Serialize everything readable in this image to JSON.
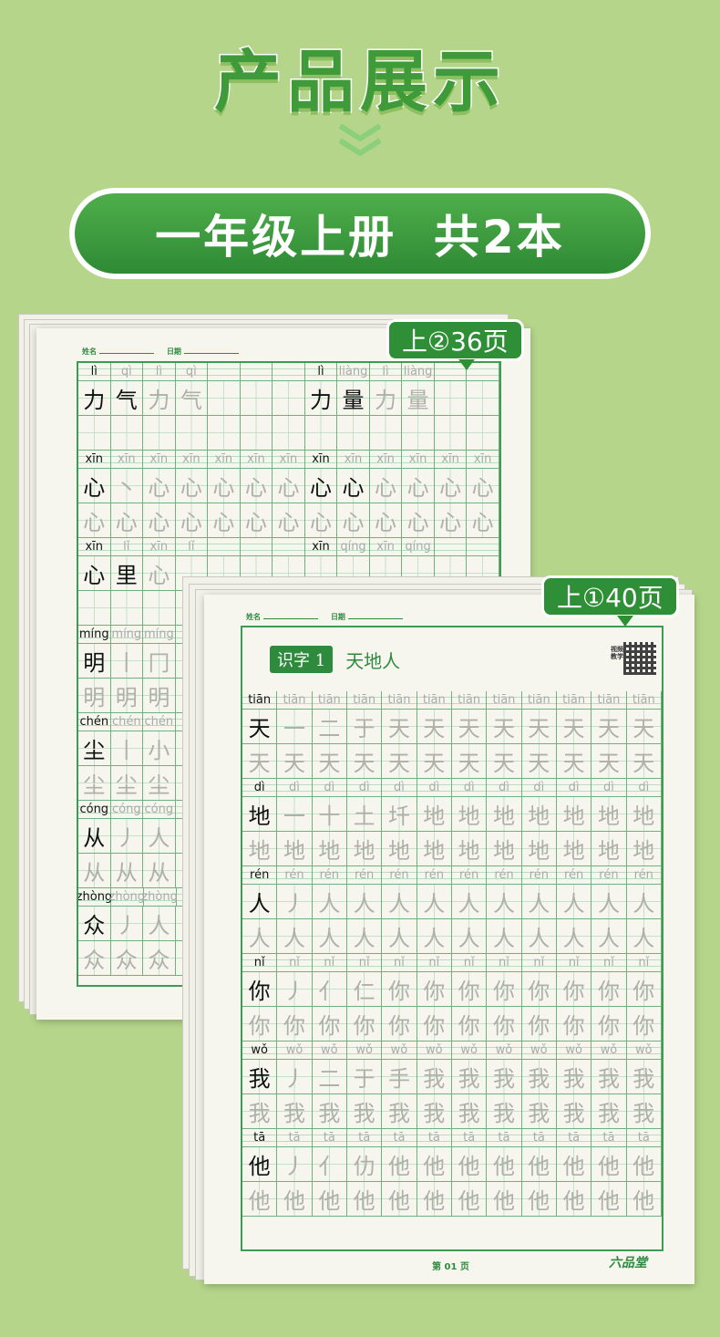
{
  "title": "产品展示",
  "banner": "一年级上册  共2本",
  "book2": {
    "badge": "上②36页",
    "name_label": "姓名",
    "date_label": "日期",
    "rows": [
      {
        "pinyin": [
          "lì",
          "qì",
          "lì",
          "qì",
          "",
          "",
          "",
          "lì",
          "liàng",
          "lì",
          "liàng",
          "",
          ""
        ],
        "hanzi": [
          "力",
          "气",
          "力",
          "气",
          "",
          "",
          "",
          "力",
          "量",
          "力",
          "量",
          "",
          ""
        ]
      },
      {
        "pinyin": [
          "xīn",
          "xīn",
          "xīn",
          "xīn",
          "xīn",
          "xīn",
          "xīn",
          "xīn",
          "xīn",
          "xīn",
          "xīn",
          "xīn",
          "xīn"
        ],
        "hanzi": [
          "心",
          "丶",
          "心",
          "心",
          "心",
          "心",
          "心",
          "心",
          "心",
          "心",
          "心",
          "心",
          "心"
        ]
      },
      {
        "pinyin": [
          "xīn",
          "lǐ",
          "xīn",
          "lǐ",
          "",
          "",
          "",
          "xīn",
          "qíng",
          "xīn",
          "qíng",
          "",
          ""
        ],
        "hanzi": [
          "心",
          "里",
          "心",
          "",
          "",
          "",
          "",
          "",
          "",
          "",
          "",
          "",
          ""
        ]
      },
      {
        "pinyin": [
          "míng",
          "míng",
          "míng"
        ],
        "hanzi": [
          "明",
          "丨",
          "冂"
        ]
      },
      {
        "pinyin": [
          "chén",
          "chén",
          "chén"
        ],
        "hanzi": [
          "尘",
          "丨",
          "小"
        ]
      },
      {
        "pinyin": [
          "cóng",
          "cóng",
          "cóng"
        ],
        "hanzi": [
          "从",
          "丿",
          "人"
        ]
      },
      {
        "pinyin": [
          "zhòng",
          "zhòng",
          "zhòng"
        ],
        "hanzi": [
          "众",
          "丿",
          "人"
        ]
      }
    ]
  },
  "book1": {
    "badge": "上①40页",
    "name_label": "姓名",
    "date_label": "日期",
    "lesson_tag": "识字 1",
    "lesson_name": "天地人",
    "qr_label": "视频教学",
    "page_label": "第 01 页",
    "brand": "六品堂",
    "rows": [
      {
        "pinyin": "tiān",
        "char": "天",
        "strokes": [
          "一",
          "二",
          "于",
          "天",
          "天",
          "天",
          "天",
          "天",
          "天",
          "天",
          "天"
        ]
      },
      {
        "pinyin": "dì",
        "char": "地",
        "strokes": [
          "一",
          "十",
          "土",
          "圲",
          "地",
          "地",
          "地",
          "地",
          "地",
          "地",
          "地"
        ]
      },
      {
        "pinyin": "rén",
        "char": "人",
        "strokes": [
          "丿",
          "人",
          "人",
          "人",
          "人",
          "人",
          "人",
          "人",
          "人",
          "人",
          "人"
        ]
      },
      {
        "pinyin": "nǐ",
        "char": "你",
        "strokes": [
          "丿",
          "亻",
          "仁",
          "你",
          "你",
          "你",
          "你",
          "你",
          "你",
          "你",
          "你"
        ]
      },
      {
        "pinyin": "wǒ",
        "char": "我",
        "strokes": [
          "丿",
          "二",
          "于",
          "手",
          "我",
          "我",
          "我",
          "我",
          "我",
          "我",
          "我"
        ]
      },
      {
        "pinyin": "tā",
        "char": "他",
        "strokes": [
          "丿",
          "亻",
          "仂",
          "他",
          "他",
          "他",
          "他",
          "他",
          "他",
          "他",
          "他"
        ]
      }
    ]
  },
  "colors": {
    "background": "#b5d68a",
    "primary_green": "#2e8b3e",
    "grid_green": "#6db27c"
  }
}
